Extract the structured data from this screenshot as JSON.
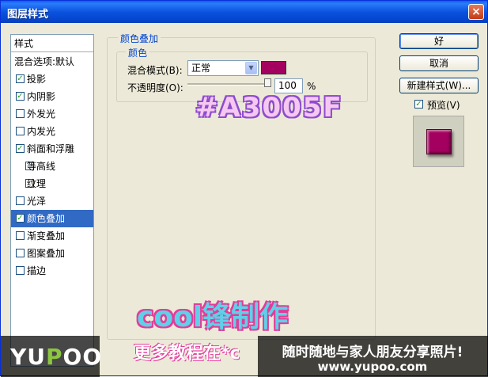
{
  "window": {
    "title": "图层样式",
    "close_symbol": "×"
  },
  "sidebar": {
    "header": "样式",
    "blend_options": "混合选项:默认",
    "items": [
      {
        "label": "投影",
        "checked": true,
        "indent": false,
        "selected": false
      },
      {
        "label": "内阴影",
        "checked": true,
        "indent": false,
        "selected": false
      },
      {
        "label": "外发光",
        "checked": false,
        "indent": false,
        "selected": false
      },
      {
        "label": "内发光",
        "checked": false,
        "indent": false,
        "selected": false
      },
      {
        "label": "斜面和浮雕",
        "checked": true,
        "indent": false,
        "selected": false
      },
      {
        "label": "等高线",
        "checked": false,
        "indent": true,
        "selected": false
      },
      {
        "label": "纹理",
        "checked": false,
        "indent": true,
        "selected": false
      },
      {
        "label": "光泽",
        "checked": false,
        "indent": false,
        "selected": false
      },
      {
        "label": "颜色叠加",
        "checked": true,
        "indent": false,
        "selected": true
      },
      {
        "label": "渐变叠加",
        "checked": false,
        "indent": false,
        "selected": false
      },
      {
        "label": "图案叠加",
        "checked": false,
        "indent": false,
        "selected": false
      },
      {
        "label": "描边",
        "checked": false,
        "indent": false,
        "selected": false
      }
    ]
  },
  "panel": {
    "section_title": "颜色叠加",
    "group_title": "颜色",
    "blend_mode_label": "混合模式(B):",
    "blend_mode_value": "正常",
    "opacity_label": "不透明度(O):",
    "opacity_value": "100",
    "opacity_percent": 100,
    "opacity_unit": "%",
    "overlay_color": "#A3005F"
  },
  "buttons": {
    "ok": "好",
    "cancel": "取消",
    "new_style": "新建样式(W)...",
    "preview_label": "预览(V)",
    "preview_checked": true
  },
  "overlay": {
    "hex_text": "#A3005F",
    "brand_text": "cool锋制作",
    "more_text": "更多教程在*c"
  },
  "watermark": {
    "logo_pre": "YU",
    "logo_p": "P",
    "logo_post": "OO",
    "slogan": "随时随地与家人朋友分享照片!",
    "url": "www.yupoo.com"
  },
  "colors": {
    "accent": "#316AC5",
    "swatch": "#A3005F",
    "title_bar": "#0A53DF"
  }
}
